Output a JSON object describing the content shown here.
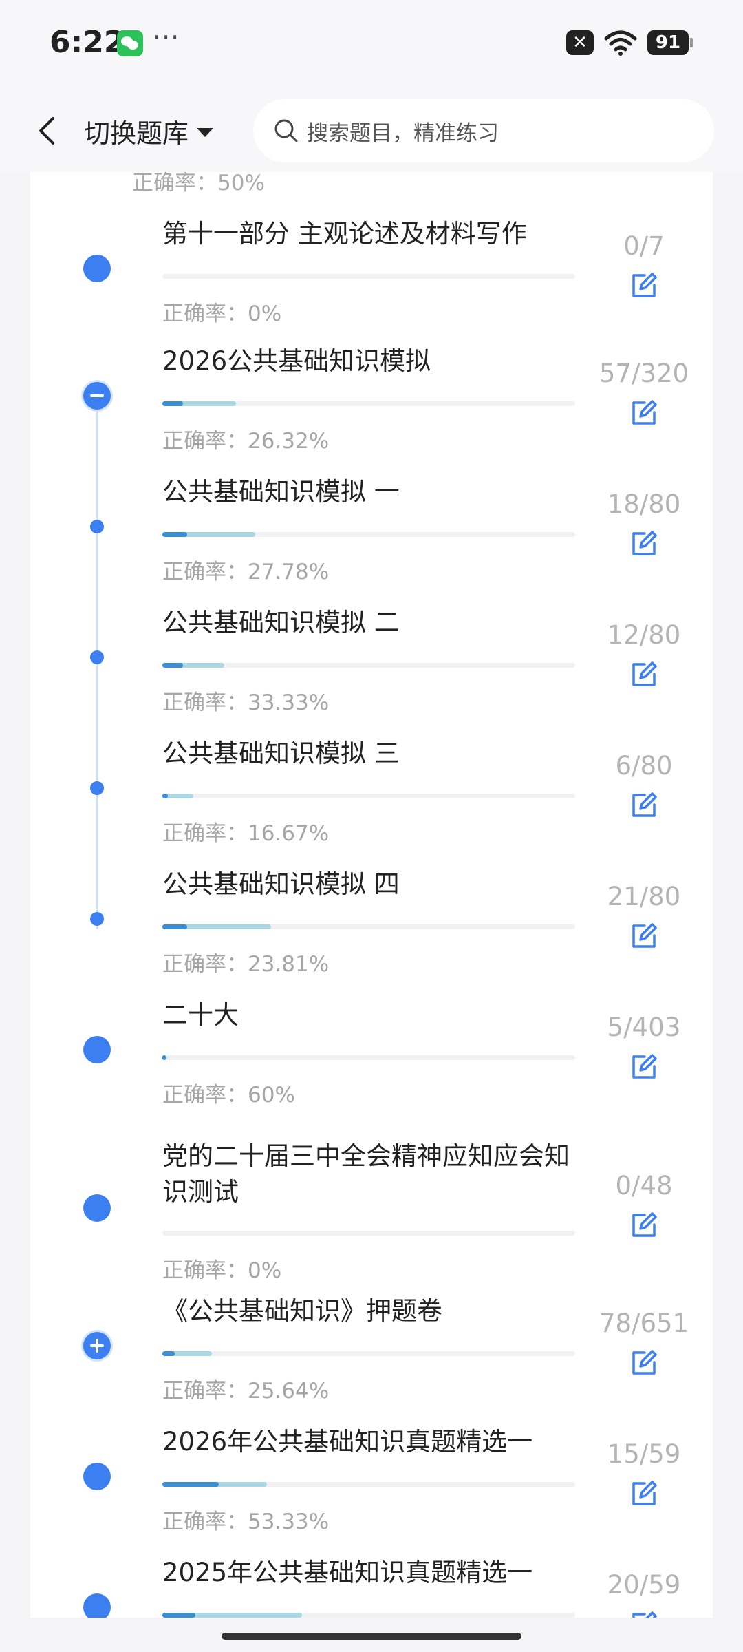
{
  "status": {
    "time": "6:22",
    "dots": "···",
    "battery": "91",
    "close_glyph": "✕"
  },
  "header": {
    "switch_label": "切换题库",
    "search_placeholder": "搜索题目，精准练习"
  },
  "partial_prev_accuracy": "正确率：50%",
  "items": [
    {
      "title": "第十一部分 主观论述及材料写作",
      "count": "0/7",
      "accuracy": "正确率：0%",
      "node": "big",
      "progress": 0,
      "total_fill": 0
    },
    {
      "title": "2026公共基础知识模拟",
      "count": "57/320",
      "accuracy": "正确率：26.32%",
      "node": "minus",
      "progress": 0.05,
      "total_fill": 0.178
    },
    {
      "title": "公共基础知识模拟 一",
      "count": "18/80",
      "accuracy": "正确率：27.78%",
      "node": "small",
      "progress": 0.06,
      "total_fill": 0.225
    },
    {
      "title": "公共基础知识模拟 二",
      "count": "12/80",
      "accuracy": "正确率：33.33%",
      "node": "small",
      "progress": 0.05,
      "total_fill": 0.15
    },
    {
      "title": "公共基础知识模拟 三",
      "count": "6/80",
      "accuracy": "正确率：16.67%",
      "node": "small",
      "progress": 0.013,
      "total_fill": 0.075
    },
    {
      "title": "公共基础知识模拟 四",
      "count": "21/80",
      "accuracy": "正确率：23.81%",
      "node": "small",
      "progress": 0.06,
      "total_fill": 0.263
    },
    {
      "title": "二十大",
      "count": "5/403",
      "accuracy": "正确率：60%",
      "node": "big",
      "progress": 0.007,
      "total_fill": 0.012
    },
    {
      "title": "党的二十届三中全会精神应知应会知识测试",
      "count": "0/48",
      "accuracy": "正确率：0%",
      "node": "big",
      "progress": 0,
      "total_fill": 0
    },
    {
      "title": "《公共基础知识》押题卷",
      "count": "78/651",
      "accuracy": "正确率：25.64%",
      "node": "plus",
      "progress": 0.03,
      "total_fill": 0.12
    },
    {
      "title": "2026年公共基础知识真题精选一",
      "count": "15/59",
      "accuracy": "正确率：53.33%",
      "node": "big",
      "progress": 0.136,
      "total_fill": 0.254
    },
    {
      "title": "2025年公共基础知识真题精选一",
      "count": "20/59",
      "accuracy": "",
      "node": "big",
      "progress": 0.08,
      "total_fill": 0.339
    }
  ],
  "colors": {
    "accent": "#3c7ff0",
    "progress_light": "#a9d7e3",
    "progress_dark": "#3d8fd4"
  }
}
